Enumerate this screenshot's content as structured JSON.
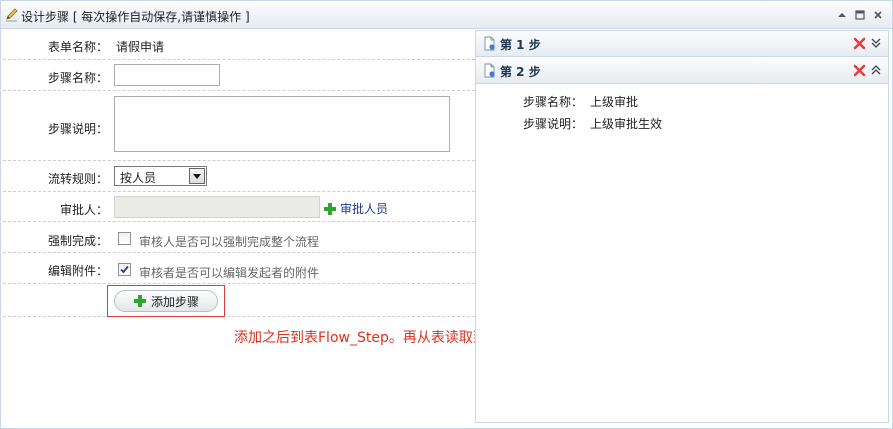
{
  "panel": {
    "title": "设计步骤 [ 每次操作自动保存,请谨慎操作 ]"
  },
  "form": {
    "form_name_label": "表单名称：",
    "form_name_value": "请假申请",
    "step_name_label": "步骤名称：",
    "step_name_value": "",
    "step_desc_label": "步骤说明：",
    "step_desc_value": "",
    "flow_rule_label": "流转规则：",
    "flow_rule_selected": "按人员",
    "approver_label": "审批人：",
    "approver_value": "",
    "approver_link": "审批人员",
    "force_complete_label": "强制完成：",
    "force_complete_text": "审核人是否可以强制完成整个流程",
    "force_complete_checked": false,
    "edit_attach_label": "编辑附件：",
    "edit_attach_text": "审核者是否可以编辑发起者的附件",
    "edit_attach_checked": true,
    "add_step_button": "添加步骤"
  },
  "note": "添加之后到表Flow_Step。再从表读取到右边的手风琴",
  "accordion": {
    "steps": [
      {
        "title": "第 1 步",
        "expanded": false
      },
      {
        "title": "第 2 步",
        "expanded": true,
        "name_label": "步骤名称：",
        "name_value": "上级审批",
        "desc_label": "步骤说明：",
        "desc_value": "上级审批生效"
      }
    ]
  },
  "colors": {
    "accent_red": "#e0301e",
    "link_blue": "#1a3b8f",
    "border": "#c9d7e8",
    "add_green": "#2fa52f"
  }
}
